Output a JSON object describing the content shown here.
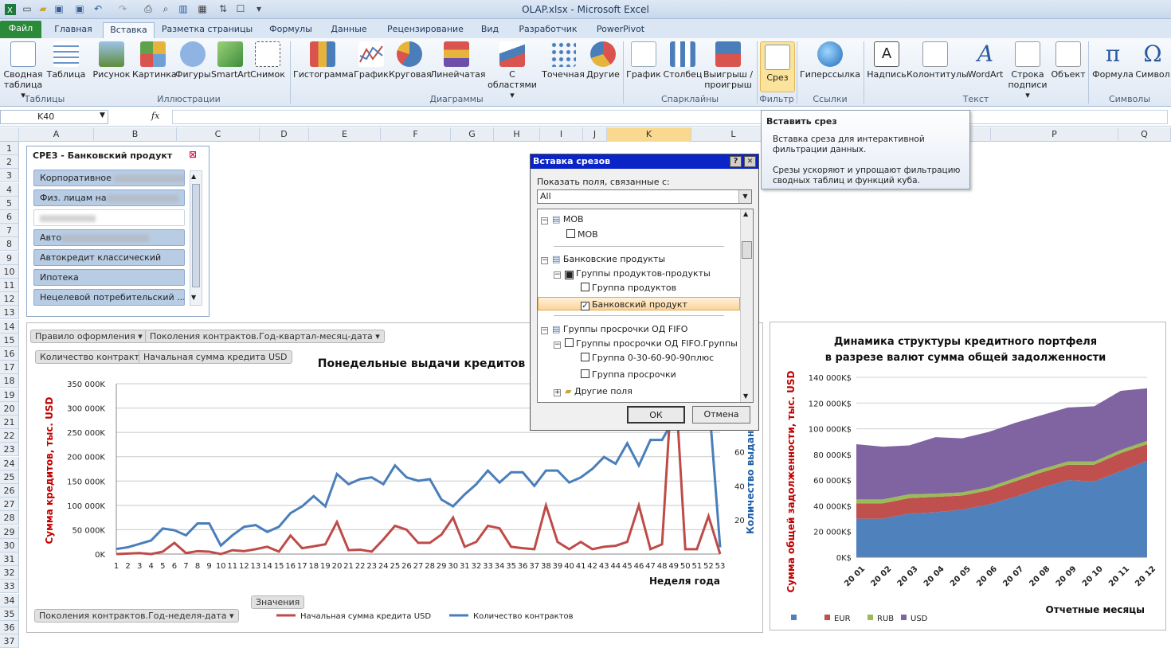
{
  "window": {
    "title": "OLAP.xlsx  -  Microsoft Excel"
  },
  "tabs": [
    "Файл",
    "Главная",
    "Вставка",
    "Разметка страницы",
    "Формулы",
    "Данные",
    "Рецензирование",
    "Вид",
    "Разработчик",
    "PowerPivot"
  ],
  "ribbon": {
    "buttons": [
      "Сводная\nтаблица ▾",
      "Таблица",
      "Рисунок",
      "Картинка",
      "Фигуры",
      "SmartArt",
      "Снимок",
      "Гистограмма",
      "График",
      "Круговая",
      "Линейчатая",
      "С\nобластями ▾",
      "Точечная",
      "Другие",
      "График",
      "Столбец",
      "Выигрыш /\nпроигрыш",
      "Срез",
      "Гиперссылка",
      "Надпись",
      "Колонтитулы",
      "WordArt",
      "Строка\nподписи ▾",
      "Объект",
      "Формула",
      "Символ"
    ],
    "groups": [
      "Таблицы",
      "Иллюстрации",
      "Диаграммы",
      "Спарклайны",
      "Фильтр",
      "Ссылки",
      "Текст",
      "Символы"
    ]
  },
  "formula_bar": {
    "name_box": "K40",
    "fx": "fx",
    "content": ""
  },
  "columns": [
    "A",
    "B",
    "C",
    "D",
    "E",
    "F",
    "G",
    "H",
    "I",
    "J",
    "K",
    "L",
    "M",
    "N",
    "O",
    "P",
    "Q"
  ],
  "rows": [
    "1",
    "2",
    "3",
    "4",
    "5",
    "6",
    "7",
    "8",
    "9",
    "10",
    "11",
    "12",
    "13",
    "14",
    "15",
    "16",
    "17",
    "18",
    "19",
    "20",
    "21",
    "22",
    "23",
    "24",
    "25",
    "26",
    "27",
    "28",
    "29",
    "30",
    "31",
    "32",
    "33",
    "34",
    "35",
    "36",
    "37"
  ],
  "slicer": {
    "title": "СРЕЗ - Банковский продукт",
    "items": [
      "Корпоративное ",
      "Физ. лицам на",
      "",
      "Авто",
      "Автокредит классический",
      "Ипотека",
      "Нецелевой потребительский ..."
    ]
  },
  "dialog": {
    "title": "Вставка срезов",
    "help": "?",
    "close": "✕",
    "label": "Показать поля, связанные с:",
    "select": "All",
    "tree": {
      "mob": "MOB",
      "mob_child": "MOB",
      "bp": "Банковские продукты",
      "bp_group": "Группы продуктов-продукты",
      "bp_child1": "Группа продуктов",
      "bp_child2": "Банковский продукт",
      "od": "Группы просрочки ОД FIFO",
      "od_group": "Группы просрочки ОД FIFO.Группы",
      "od_child1": "Группа 0-30-60-90-90плюс",
      "od_child2": "Группа просрочки",
      "other": "Другие поля"
    },
    "ok": "ОК",
    "cancel": "Отмена"
  },
  "tooltip": {
    "title": "Вставить срез",
    "line1": "Вставка среза для интерактивной",
    "line2": "фильтрации данных.",
    "line3": "Срезы ускоряют и упрощают фильтрацию",
    "line4": "сводных таблиц и функций куба."
  },
  "chart1_buttons": {
    "filter1": "Правило оформления",
    "filter2": "Поколения контрактов.Год-квартал-месяц-дата",
    "val1": "Количество контрактов",
    "val2": "Начальная сумма кредита USD",
    "values_btn": "Значения",
    "axis_btn": "Поколения контрактов.Год-неделя-дата"
  },
  "chart_data": [
    {
      "type": "line",
      "title": "Понедельные выдачи кредитов",
      "xlabel": "Неделя года",
      "ylabel": "Сумма кредитов, тыс. USD",
      "y2label": "Количество выданных контра",
      "categories": [
        "1",
        "2",
        "3",
        "4",
        "5",
        "6",
        "7",
        "8",
        "9",
        "10",
        "11",
        "12",
        "13",
        "14",
        "15",
        "16",
        "17",
        "18",
        "19",
        "20",
        "21",
        "22",
        "23",
        "24",
        "25",
        "26",
        "27",
        "28",
        "29",
        "30",
        "31",
        "32",
        "33",
        "34",
        "35",
        "36",
        "37",
        "38",
        "39",
        "40",
        "41",
        "42",
        "43",
        "44",
        "45",
        "46",
        "47",
        "48",
        "49",
        "50",
        "51",
        "52",
        "53"
      ],
      "yticks": [
        "0K",
        "50 000K",
        "100 000K",
        "150 000K",
        "200 000K",
        "250 000K",
        "300 000K",
        "350 000K"
      ],
      "ylim": [
        0,
        350000
      ],
      "y2ticks": [
        "20",
        "40",
        "60",
        "80"
      ],
      "y2lim": [
        0,
        100
      ],
      "series": [
        {
          "name": "Начальная сумма кредита USD",
          "color": "#be4b48",
          "axis": "left",
          "values": [
            0,
            1000,
            2000,
            0,
            5000,
            23000,
            2000,
            6000,
            5000,
            0,
            8000,
            6000,
            10000,
            15000,
            5000,
            38000,
            12000,
            16000,
            20000,
            66000,
            8000,
            9000,
            5000,
            30000,
            58000,
            50000,
            23000,
            23000,
            40000,
            75000,
            15000,
            25000,
            58000,
            53000,
            15000,
            12000,
            10000,
            100000,
            25000,
            10000,
            25000,
            10000,
            15000,
            17000,
            25000,
            100000,
            10000,
            20000,
            410000,
            10000,
            10000,
            78000,
            0
          ]
        },
        {
          "name": "Количество контрактов",
          "color": "#4a7ebb",
          "axis": "right",
          "values": [
            3,
            4,
            6,
            8,
            15,
            14,
            11,
            18,
            18,
            5,
            11,
            16,
            17,
            13,
            16,
            24,
            28,
            34,
            28,
            47,
            41,
            44,
            45,
            41,
            52,
            45,
            43,
            44,
            32,
            28,
            35,
            41,
            49,
            42,
            48,
            48,
            40,
            49,
            49,
            42,
            45,
            50,
            57,
            53,
            65,
            52,
            67,
            67,
            79,
            77,
            84,
            93,
            4
          ]
        }
      ]
    },
    {
      "type": "area",
      "title": "Динамика  структуры  кредитного портфеля\nв разрезе  валют сумма общей задолженности",
      "xlabel": "Отчетные месяцы",
      "ylabel": "Сумма общей задолженности, тыс. USD",
      "categories": [
        "20  01",
        "20  02",
        "20  03",
        "20  04",
        "20  05",
        "20  06",
        "20  07",
        "20  08",
        "20  09",
        "20 10",
        "20 11",
        "20  12"
      ],
      "yticks": [
        "0K$",
        "20 000K$",
        "40 000K$",
        "60 000K$",
        "80 000K$",
        "100 000K$",
        "120 000K$",
        "140 000K$"
      ],
      "ylim": [
        0,
        140000
      ],
      "series": [
        {
          "name": "",
          "color": "#4f81bd",
          "values": [
            30000,
            30000,
            34000,
            35000,
            37000,
            41000,
            47000,
            54000,
            60000,
            59000,
            67000,
            75000
          ]
        },
        {
          "name": "EUR",
          "color": "#c0504d",
          "values": [
            12000,
            12000,
            12000,
            12000,
            11000,
            11000,
            12000,
            12000,
            12000,
            13000,
            14000,
            13000
          ]
        },
        {
          "name": "RUB",
          "color": "#9bbb59",
          "values": [
            3000,
            3000,
            3000,
            2500,
            2500,
            2500,
            2500,
            2500,
            2500,
            2500,
            2500,
            2500
          ]
        },
        {
          "name": "USD",
          "color": "#8064a2",
          "values": [
            43000,
            41000,
            38000,
            44000,
            42000,
            43000,
            43000,
            42000,
            42000,
            43000,
            46000,
            41000
          ]
        }
      ]
    }
  ]
}
